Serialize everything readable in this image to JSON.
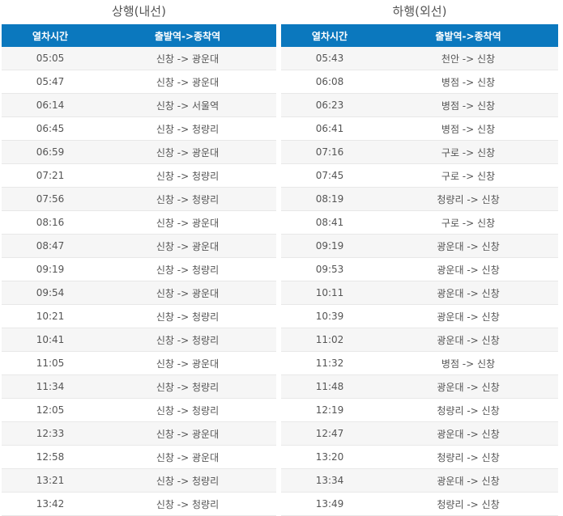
{
  "upbound": {
    "title": "상행(내선)",
    "headers": [
      "열차시간",
      "출발역->종착역"
    ],
    "rows": [
      [
        "05:05",
        "신창 -> 광운대"
      ],
      [
        "05:47",
        "신창 -> 광운대"
      ],
      [
        "06:14",
        "신창 -> 서울역"
      ],
      [
        "06:45",
        "신창 -> 청량리"
      ],
      [
        "06:59",
        "신창 -> 광운대"
      ],
      [
        "07:21",
        "신창 -> 청량리"
      ],
      [
        "07:56",
        "신창 -> 청량리"
      ],
      [
        "08:16",
        "신창 -> 광운대"
      ],
      [
        "08:47",
        "신창 -> 광운대"
      ],
      [
        "09:19",
        "신창 -> 청량리"
      ],
      [
        "09:54",
        "신창 -> 광운대"
      ],
      [
        "10:21",
        "신창 -> 청량리"
      ],
      [
        "10:41",
        "신창 -> 청량리"
      ],
      [
        "11:05",
        "신창 -> 광운대"
      ],
      [
        "11:34",
        "신창 -> 청량리"
      ],
      [
        "12:05",
        "신창 -> 청량리"
      ],
      [
        "12:33",
        "신창 -> 광운대"
      ],
      [
        "12:58",
        "신창 -> 광운대"
      ],
      [
        "13:21",
        "신창 -> 청량리"
      ],
      [
        "13:42",
        "신창 -> 청량리"
      ]
    ]
  },
  "downbound": {
    "title": "하행(외선)",
    "headers": [
      "열차시간",
      "출발역->종착역"
    ],
    "rows": [
      [
        "05:43",
        "천안 -> 신창"
      ],
      [
        "06:08",
        "병점 -> 신창"
      ],
      [
        "06:23",
        "병점 -> 신창"
      ],
      [
        "06:41",
        "병점 -> 신창"
      ],
      [
        "07:16",
        "구로 -> 신창"
      ],
      [
        "07:45",
        "구로 -> 신창"
      ],
      [
        "08:19",
        "청량리 -> 신창"
      ],
      [
        "08:41",
        "구로 -> 신창"
      ],
      [
        "09:19",
        "광운대 -> 신창"
      ],
      [
        "09:53",
        "광운대 -> 신창"
      ],
      [
        "10:11",
        "광운대 -> 신창"
      ],
      [
        "10:39",
        "광운대 -> 신창"
      ],
      [
        "11:02",
        "광운대 -> 신창"
      ],
      [
        "11:32",
        "병점 -> 신창"
      ],
      [
        "11:48",
        "광운대 -> 신창"
      ],
      [
        "12:19",
        "청량리 -> 신창"
      ],
      [
        "12:47",
        "광운대 -> 신창"
      ],
      [
        "13:20",
        "청량리 -> 신창"
      ],
      [
        "13:34",
        "광운대 -> 신창"
      ],
      [
        "13:49",
        "청량리 -> 신창"
      ]
    ]
  }
}
